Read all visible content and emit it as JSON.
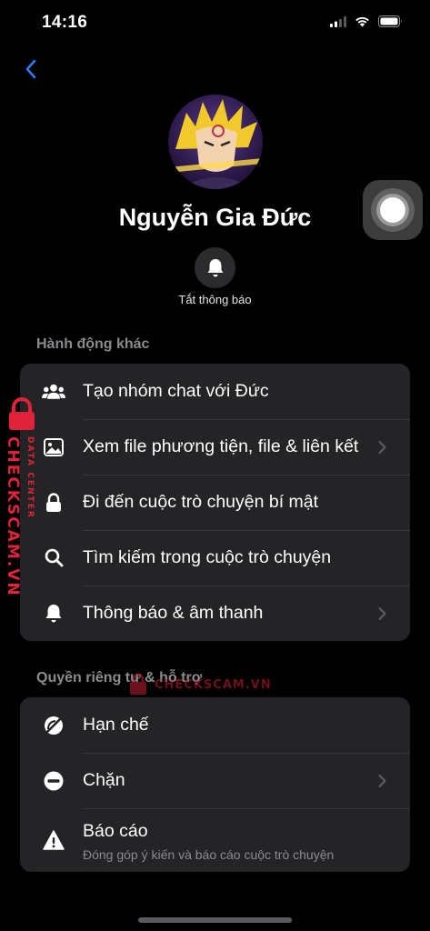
{
  "status_bar": {
    "time": "14:16",
    "icons": [
      "cellular-signal-icon",
      "wifi-icon",
      "battery-icon"
    ]
  },
  "navigation": {
    "back_icon": "chevron-left-icon",
    "accent_color": "#2f7bf5"
  },
  "profile": {
    "name": "Nguyễn Gia Đức",
    "mute_icon": "bell-icon",
    "mute_label": "Tắt thông báo"
  },
  "sections": {
    "other_actions": {
      "header": "Hành động khác",
      "items": [
        {
          "label": "Tạo nhóm chat với Đức",
          "icon": "group-icon",
          "chevron": false
        },
        {
          "label": "Xem file phương tiện, file & liên kết",
          "icon": "photo-icon",
          "chevron": true
        },
        {
          "label": "Đi đến cuộc trò chuyện bí mật",
          "icon": "lock-icon",
          "chevron": false
        },
        {
          "label": "Tìm kiếm trong cuộc trò chuyện",
          "icon": "search-icon",
          "chevron": false
        },
        {
          "label": "Thông báo & âm thanh",
          "icon": "bell-icon",
          "chevron": true
        }
      ]
    },
    "privacy_support": {
      "header": "Quyền riêng tư & hỗ trợ",
      "items": [
        {
          "label": "Hạn chế",
          "icon": "restrict-icon",
          "chevron": false
        },
        {
          "label": "Chặn",
          "icon": "block-icon",
          "chevron": true
        },
        {
          "label": "Báo cáo",
          "sublabel": "Đóng góp ý kiến và báo cáo cuộc trò chuyện",
          "icon": "warning-icon",
          "chevron": false
        }
      ]
    }
  },
  "watermark": {
    "side_brand": "CHECKSCAM.VN",
    "side_tag": "DATA CENTER",
    "center_text": "CHECKSCAM.VN",
    "color": "#e0233a"
  }
}
